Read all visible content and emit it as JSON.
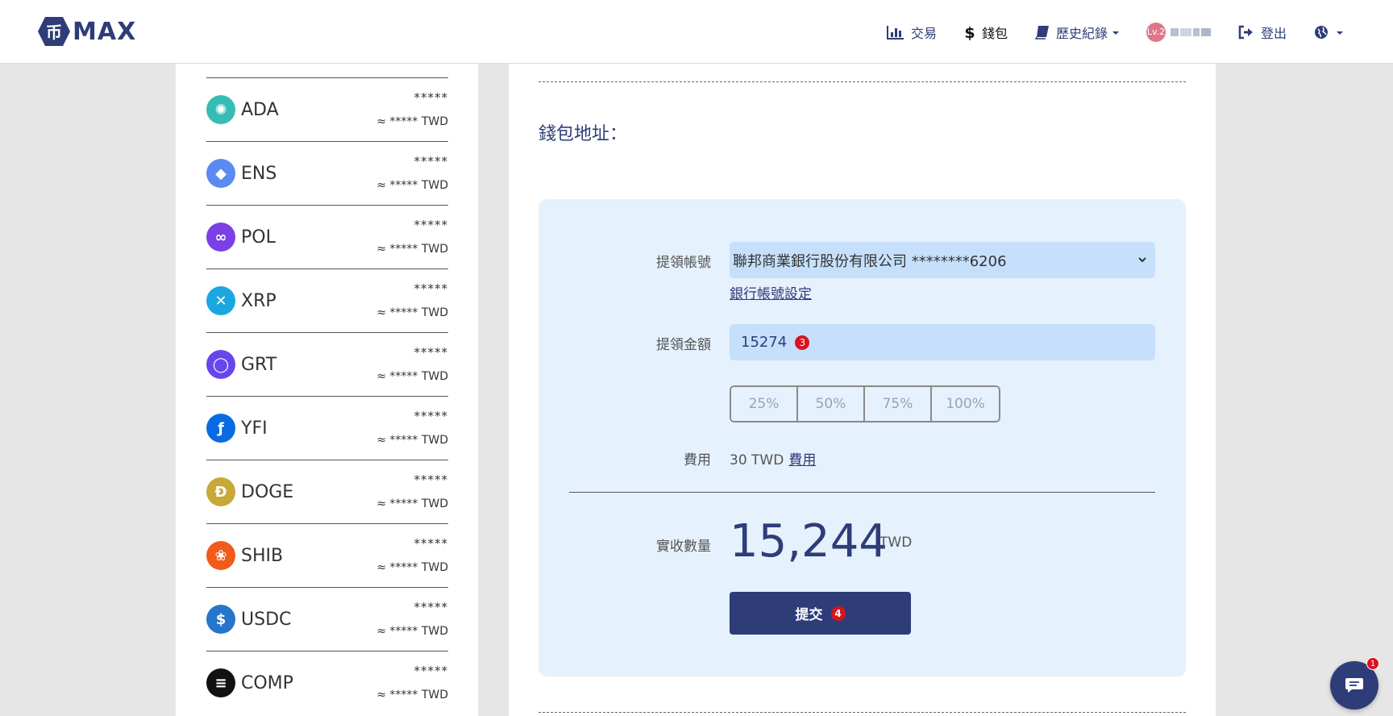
{
  "brand": {
    "name": "MAX"
  },
  "nav": {
    "trade_label": "交易",
    "wallet_label": "錢包",
    "history_label": "歷史紀錄",
    "level_badge": "Lv.2",
    "logout_label": "登出"
  },
  "coins": [
    {
      "symbol": "ADA",
      "balance": "*****",
      "twd": "≈ ***** TWD",
      "icon": "ada-icon",
      "color": "#36bcb4"
    },
    {
      "symbol": "ENS",
      "balance": "*****",
      "twd": "≈ ***** TWD",
      "icon": "ens-icon",
      "color": "#5a8bf0"
    },
    {
      "symbol": "POL",
      "balance": "*****",
      "twd": "≈ ***** TWD",
      "icon": "pol-icon",
      "color": "#7b3fe4"
    },
    {
      "symbol": "XRP",
      "balance": "*****",
      "twd": "≈ ***** TWD",
      "icon": "xrp-icon",
      "color": "#1aa7e0"
    },
    {
      "symbol": "GRT",
      "balance": "*****",
      "twd": "≈ ***** TWD",
      "icon": "grt-icon",
      "color": "#6747ed"
    },
    {
      "symbol": "YFI",
      "balance": "*****",
      "twd": "≈ ***** TWD",
      "icon": "yfi-icon",
      "color": "#0a6ae1"
    },
    {
      "symbol": "DOGE",
      "balance": "*****",
      "twd": "≈ ***** TWD",
      "icon": "doge-icon",
      "color": "#c8a838"
    },
    {
      "symbol": "SHIB",
      "balance": "*****",
      "twd": "≈ ***** TWD",
      "icon": "shib-icon",
      "color": "#f05a1a"
    },
    {
      "symbol": "USDC",
      "balance": "*****",
      "twd": "≈ ***** TWD",
      "icon": "usdc-icon",
      "color": "#2775ca"
    },
    {
      "symbol": "COMP",
      "balance": "*****",
      "twd": "≈ ***** TWD",
      "icon": "comp-icon",
      "color": "#111111"
    }
  ],
  "wallet": {
    "address_label": "錢包地址："
  },
  "withdraw": {
    "account_label": "提領帳號",
    "account_value": "聯邦商業銀行股份有限公司 ********6206",
    "bank_settings_link": "銀行帳號設定",
    "amount_label": "提領金額",
    "amount_value": "15274",
    "amount_step": "3",
    "percent_options": [
      "25%",
      "50%",
      "75%",
      "100%"
    ],
    "fee_label": "費用",
    "fee_value": "30 TWD",
    "fee_link": "費用",
    "receive_label": "實收數量",
    "receive_value": "15,244",
    "receive_unit": "TWD",
    "submit_label": "提交",
    "submit_step": "4"
  },
  "chat": {
    "badge_count": "1"
  },
  "colors": {
    "brand": "#2e3d78",
    "panel_bg": "#e5f1fd",
    "input_bg": "#c6e0fb",
    "alert": "#d9131d"
  }
}
